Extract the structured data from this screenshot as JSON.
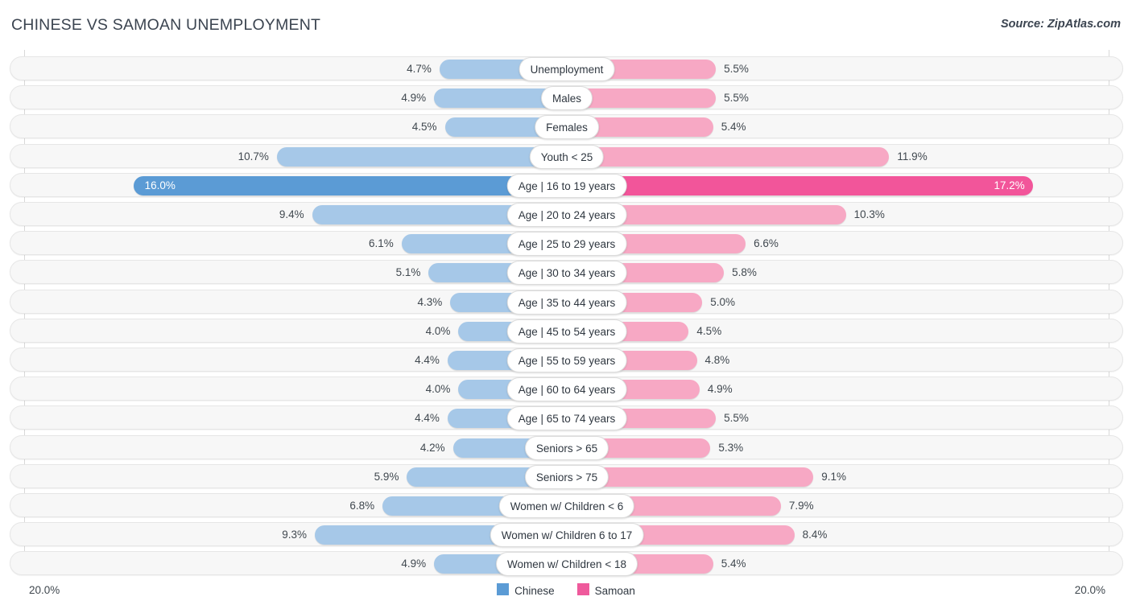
{
  "header": {
    "title": "CHINESE VS SAMOAN UNEMPLOYMENT",
    "source": "Source: ZipAtlas.com"
  },
  "axis": {
    "left_label": "20.0%",
    "right_label": "20.0%",
    "max": 20.0
  },
  "legend": {
    "items": [
      {
        "label": "Chinese",
        "color": "#5b9bd5"
      },
      {
        "label": "Samoan",
        "color": "#ef5a9c"
      }
    ]
  },
  "colors": {
    "left_bar": "#a6c8e8",
    "right_bar": "#f7a8c4",
    "left_bar_highlight": "#5b9bd5",
    "right_bar_highlight": "#f2559a",
    "track": "#f7f7f7",
    "gridline": "#d8d8d8",
    "text": "#40484f"
  },
  "chart_data": {
    "type": "bar",
    "title": "CHINESE VS SAMOAN UNEMPLOYMENT",
    "subtitle": "",
    "xlabel": "",
    "ylabel": "",
    "orientation": "horizontal-diverging",
    "xlim": [
      20.0,
      20.0
    ],
    "grid": true,
    "legend_position": "bottom-center",
    "categories": [
      "Unemployment",
      "Males",
      "Females",
      "Youth < 25",
      "Age | 16 to 19 years",
      "Age | 20 to 24 years",
      "Age | 25 to 29 years",
      "Age | 30 to 34 years",
      "Age | 35 to 44 years",
      "Age | 45 to 54 years",
      "Age | 55 to 59 years",
      "Age | 60 to 64 years",
      "Age | 65 to 74 years",
      "Seniors > 65",
      "Seniors > 75",
      "Women w/ Children < 6",
      "Women w/ Children 6 to 17",
      "Women w/ Children < 18"
    ],
    "series": [
      {
        "name": "Chinese",
        "side": "left",
        "values": [
          4.7,
          4.9,
          4.5,
          10.7,
          16.0,
          9.4,
          6.1,
          5.1,
          4.3,
          4.0,
          4.4,
          4.0,
          4.4,
          4.2,
          5.9,
          6.8,
          9.3,
          4.9
        ],
        "labels": [
          "4.7%",
          "4.9%",
          "4.5%",
          "10.7%",
          "16.0%",
          "9.4%",
          "6.1%",
          "5.1%",
          "4.3%",
          "4.0%",
          "4.4%",
          "4.0%",
          "4.4%",
          "4.2%",
          "5.9%",
          "6.8%",
          "9.3%",
          "4.9%"
        ]
      },
      {
        "name": "Samoan",
        "side": "right",
        "values": [
          5.5,
          5.5,
          5.4,
          11.9,
          17.2,
          10.3,
          6.6,
          5.8,
          5.0,
          4.5,
          4.8,
          4.9,
          5.5,
          5.3,
          9.1,
          7.9,
          8.4,
          5.4
        ],
        "labels": [
          "5.5%",
          "5.5%",
          "5.4%",
          "11.9%",
          "17.2%",
          "10.3%",
          "6.6%",
          "5.8%",
          "5.0%",
          "4.5%",
          "4.8%",
          "4.9%",
          "5.5%",
          "5.3%",
          "9.1%",
          "7.9%",
          "8.4%",
          "5.4%"
        ]
      }
    ],
    "highlighted_rows": [
      4
    ]
  }
}
